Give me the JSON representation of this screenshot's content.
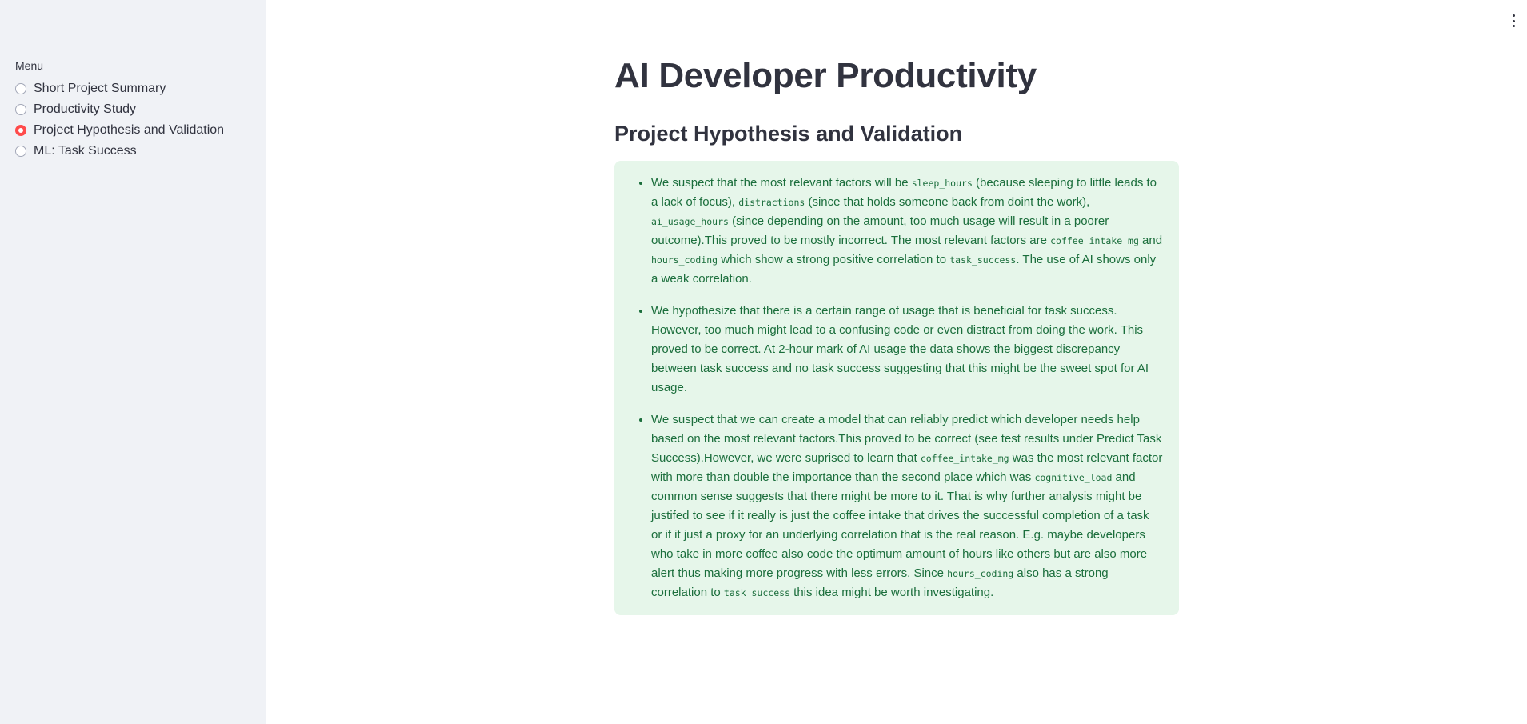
{
  "sidebar": {
    "menu_label": "Menu",
    "items": [
      {
        "label": "Short Project Summary",
        "selected": false
      },
      {
        "label": "Productivity Study",
        "selected": false
      },
      {
        "label": "Project Hypothesis and Validation",
        "selected": true
      },
      {
        "label": "ML: Task Success",
        "selected": false
      }
    ]
  },
  "header": {
    "menu_icon": "kebab-menu-icon"
  },
  "main": {
    "title": "AI Developer Productivity",
    "subtitle": "Project Hypothesis and Validation",
    "box_color": "#e6f6ea",
    "text_color": "#1b6e3c",
    "accent_color": "#ff4b4b",
    "bullets": [
      {
        "t1": "We suspect that the most relevant factors will be ",
        "c1": "sleep_hours",
        "t2": " (because sleeping to little leads to a lack of focus), ",
        "c2": "distractions",
        "t3": " (since that holds someone back from doint the work), ",
        "c3": "ai_usage_hours",
        "t4": " (since depending on the amount, too much usage will result in a poorer outcome).This proved to be mostly incorrect. The most relevant factors are ",
        "c4": "coffee_intake_mg",
        "t5": " and ",
        "c5": "hours_coding",
        "t6": " which show a strong positive correlation to ",
        "c6": "task_success",
        "t7": ". The use of AI shows only a weak correlation."
      },
      {
        "t1": "We hypothesize that there is a certain range of usage that is beneficial for task success. However, too much might lead to a confusing code or even distract from doing the work. This proved to be correct. At 2-hour mark of AI usage the data shows the biggest discrepancy between task success and no task success suggesting that this might be the sweet spot for AI usage."
      },
      {
        "t1": "We suspect that we can create a model that can reliably predict which developer needs help based on the most relevant factors.This proved to be correct (see test results under Predict Task Success).However, we were suprised to learn that ",
        "c1": "coffee_intake_mg",
        "t2": " was the most relevant factor with more than double the importance than the second place which was ",
        "c2": "cognitive_load",
        "t3": " and common sense suggests that there might be more to it. That is why further analysis might be justifed to see if it really is just the coffee intake that drives the successful completion of a task or if it just a proxy for an underlying correlation that is the real reason. E.g. maybe developers who take in more coffee also code the optimum amount of hours like others but are also more alert thus making more progress with less errors. Since ",
        "c3": "hours_coding",
        "t4": " also has a strong correlation to ",
        "c4": "task_success",
        "t5": " this idea might be worth investigating."
      }
    ]
  }
}
